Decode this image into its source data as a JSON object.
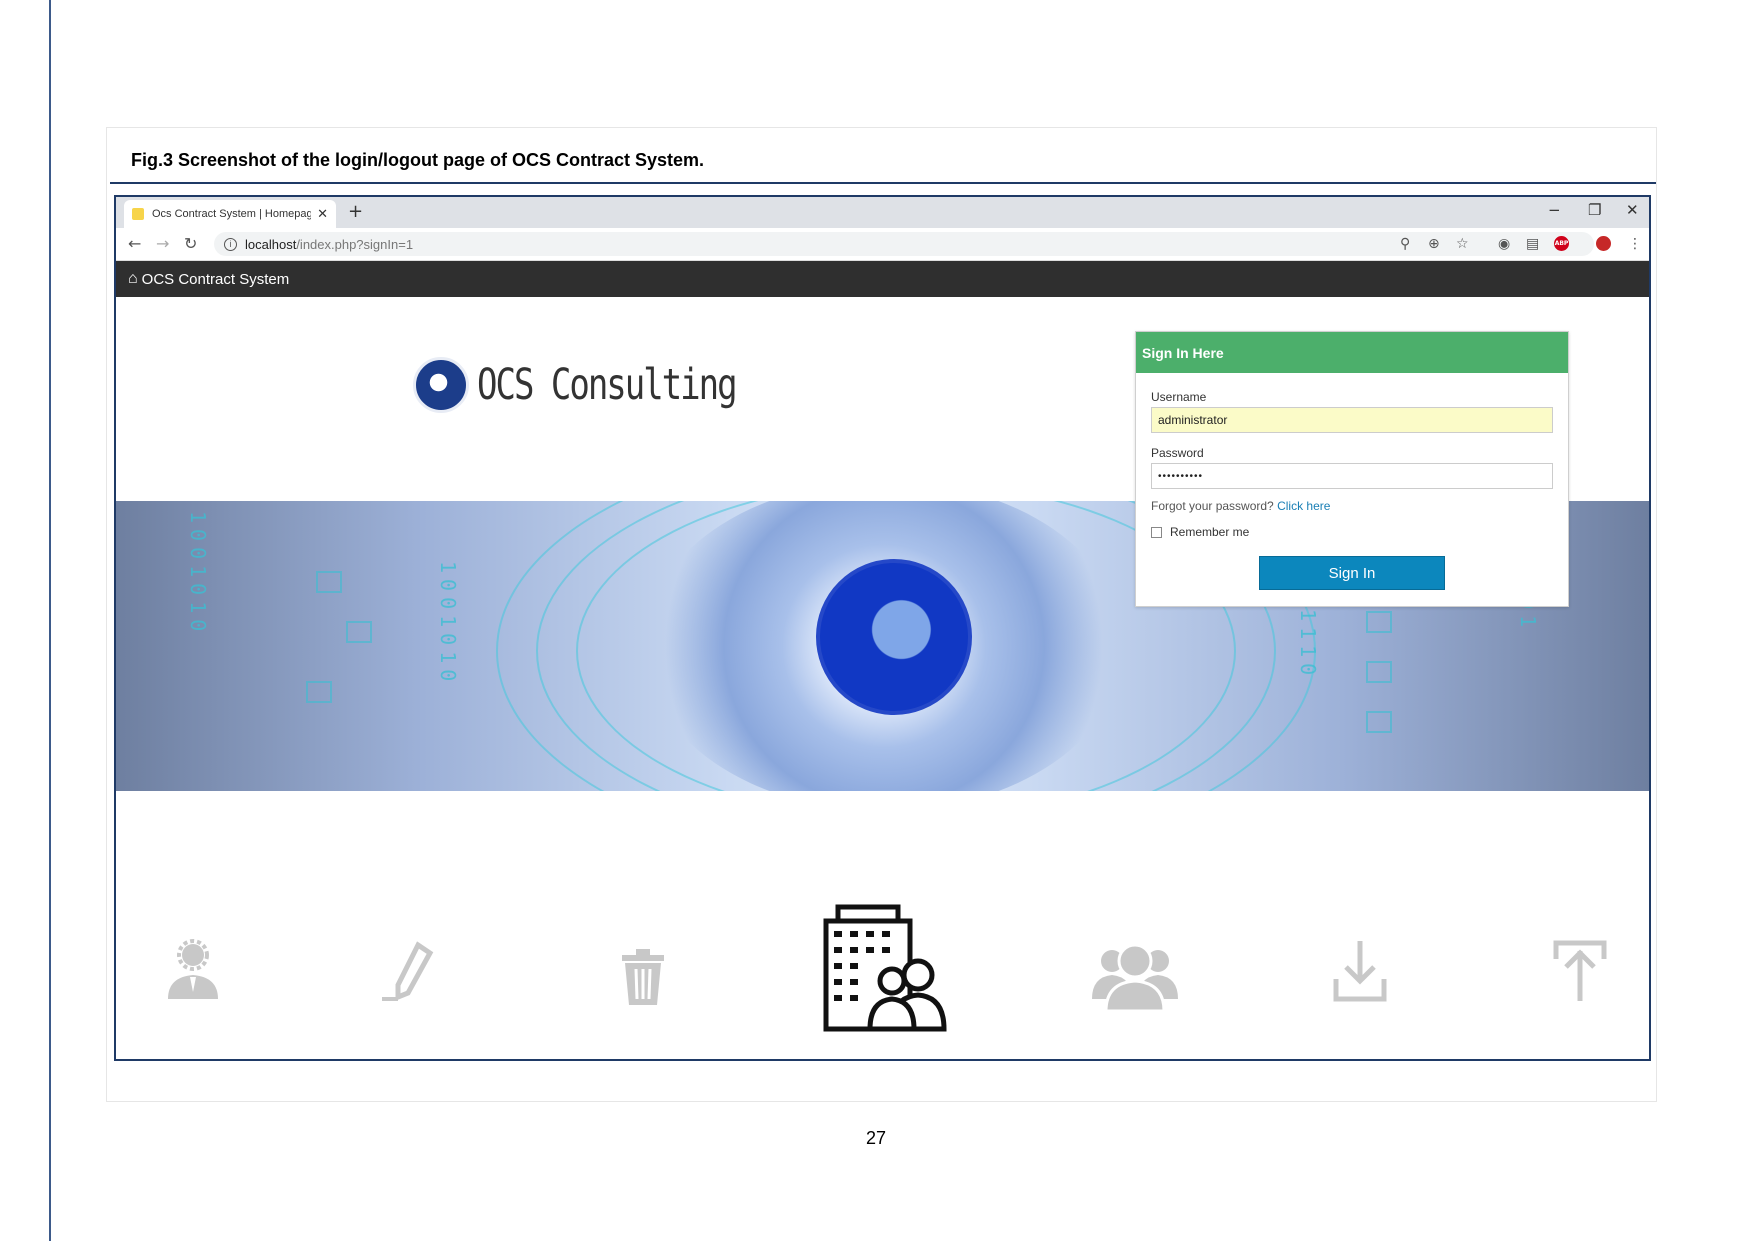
{
  "document": {
    "caption": "Fig.3 Screenshot of the login/logout page of OCS Contract System.",
    "page_number": "27"
  },
  "browser": {
    "tab_title": "Ocs Contract System | Homepag…",
    "tab_close": "✕",
    "new_tab": "+",
    "minimize": "−",
    "restore": "❐",
    "close": "✕",
    "url_host": "localhost",
    "url_path": "/index.php?signIn=1"
  },
  "app": {
    "title": "OCS Contract System",
    "logo_text": "OCS Consulting"
  },
  "signin": {
    "header": "Sign In Here",
    "username_label": "Username",
    "username_value": "administrator",
    "password_label": "Password",
    "password_value": "••••••••••",
    "forgot_text": "Forgot your password?",
    "forgot_link": "Click here",
    "remember_label": "Remember me",
    "button_label": "Sign In"
  },
  "feature_icons": [
    "manager-icon",
    "edit-icon",
    "trash-icon",
    "contracts-building-icon",
    "users-icon",
    "download-icon",
    "upload-icon"
  ],
  "colors": {
    "appbar": "#2f2f2f",
    "signin_header": "#4caf6b",
    "signin_button": "#0c87bd",
    "frame_border": "#1f3a66"
  }
}
